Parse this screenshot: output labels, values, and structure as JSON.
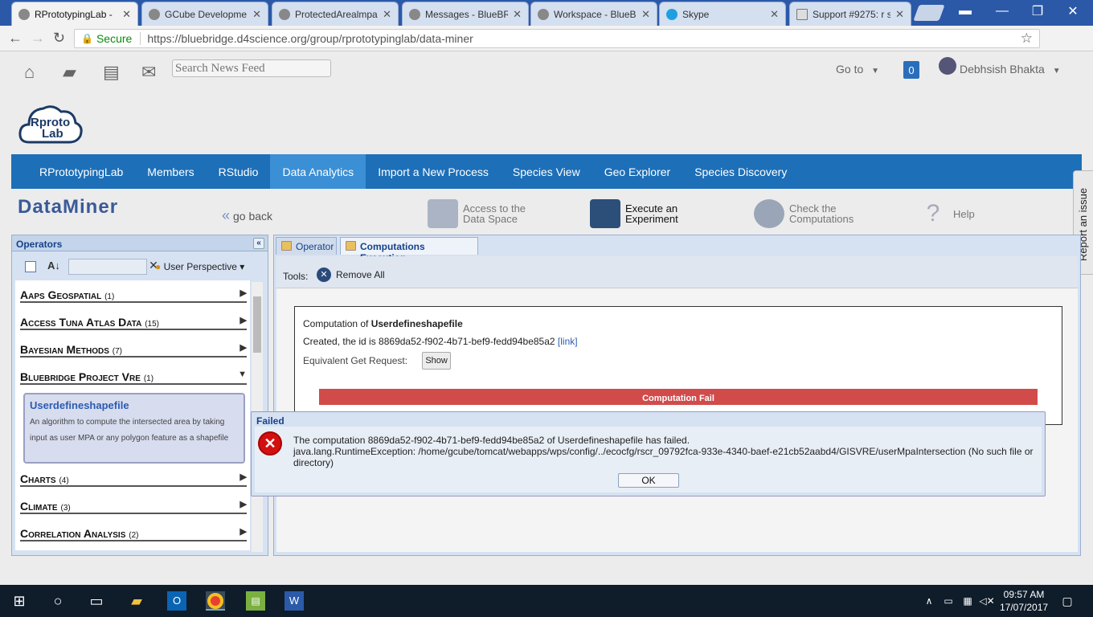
{
  "browser": {
    "tabs": [
      {
        "title": "RPrototypingLab -"
      },
      {
        "title": "GCube Developme"
      },
      {
        "title": "ProtectedArealmpa"
      },
      {
        "title": "Messages - BlueBR"
      },
      {
        "title": "Workspace - BlueB"
      },
      {
        "title": "Skype"
      },
      {
        "title": "Support #9275: r s"
      }
    ],
    "secure_label": "Secure",
    "url": "https://bluebridge.d4science.org/group/rprototypinglab/data-miner"
  },
  "topbar": {
    "search_placeholder": "Search News Feed",
    "goto_label": "Go to",
    "notif_count": "0",
    "user_name": "Debhsish Bhakta"
  },
  "logo": {
    "line1": "Rproto",
    "line2": "Lab"
  },
  "nav": {
    "items": [
      "RPrototypingLab",
      "Members",
      "RStudio",
      "Data Analytics",
      "Import a New Process",
      "Species View",
      "Geo Explorer",
      "Species Discovery"
    ]
  },
  "report_issue": "Report an issue",
  "dataminer": {
    "logo": "DataMiner",
    "go_back": "go back",
    "actions": [
      {
        "l1": "Access to the",
        "l2": "Data Space"
      },
      {
        "l1": "Execute an",
        "l2": "Experiment"
      },
      {
        "l1": "Check the",
        "l2": "Computations"
      },
      {
        "l1": "Help",
        "l2": ""
      }
    ]
  },
  "operators": {
    "title": "Operators",
    "perspective": "User Perspective",
    "categories": [
      {
        "name": "Aaps Geospatial",
        "count": "(1)"
      },
      {
        "name": "Access Tuna Atlas Data",
        "count": "(15)"
      },
      {
        "name": "Bayesian Methods",
        "count": "(7)"
      },
      {
        "name": "Bluebridge Project Vre",
        "count": "(1)"
      },
      {
        "name": "Charts",
        "count": "(4)"
      },
      {
        "name": "Climate",
        "count": "(3)"
      },
      {
        "name": "Correlation Analysis",
        "count": "(2)"
      }
    ],
    "algorithm": {
      "name": "Userdefineshapefile",
      "desc_l1": "An algorithm to compute the intersected area by taking",
      "desc_l2": "input as user MPA or any polygon feature as a shapefile"
    }
  },
  "panel": {
    "tab_operator": "Operator",
    "tab_comp": "Computations Execution",
    "tools_label": "Tools:",
    "remove_all": "Remove All"
  },
  "computation": {
    "prefix": "Computation of ",
    "name": "Userdefineshapefile",
    "created_prefix": "Created, the id is 8869da52-f902-4b71-bef9-fedd94be85a2 ",
    "link": "[link]",
    "get_request": "Equivalent Get Request:",
    "show": "Show",
    "status": "Computation Fail"
  },
  "dialog": {
    "title": "Failed",
    "msg1": "The computation 8869da52-f902-4b71-bef9-fedd94be85a2 of Userdefineshapefile has failed.",
    "msg2": "java.lang.RuntimeException: /home/gcube/tomcat/webapps/wps/config/../ecocfg/rscr_09792fca-933e-4340-baef-e21cb52aabd4/GISVRE/userMpaIntersection (No such file or directory)",
    "ok": "OK"
  },
  "taskbar": {
    "time": "09:57 AM",
    "date": "17/07/2017"
  }
}
